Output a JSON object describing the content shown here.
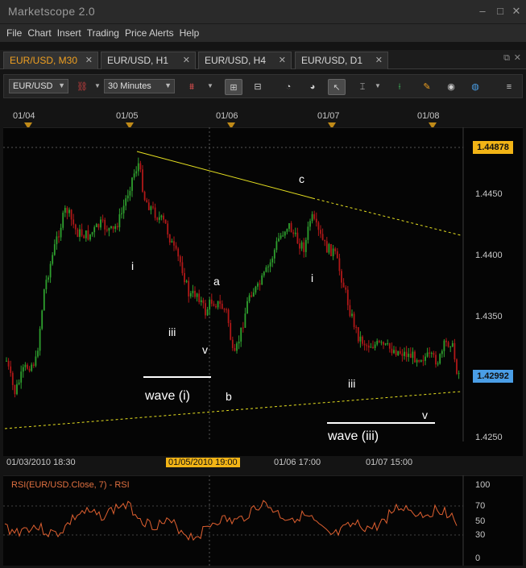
{
  "app": {
    "title": "Marketscope 2.0",
    "minimize": "–",
    "restore": "□",
    "close": "✕"
  },
  "menu": [
    "File",
    "Chart",
    "Insert",
    "Trading",
    "Price Alerts",
    "Help"
  ],
  "tabs": [
    {
      "label": "EUR/USD, M30",
      "active": true
    },
    {
      "label": "EUR/USD, H1",
      "active": false
    },
    {
      "label": "EUR/USD, H4",
      "active": false
    },
    {
      "label": "EUR/USD, D1",
      "active": false
    }
  ],
  "toolbar": {
    "instrument": "EUR/USD",
    "timeframe": "30 Minutes",
    "icons": [
      "link-icon",
      "candles-icon",
      "bar-mode-icon",
      "line-mode-icon",
      "zoom-in-icon",
      "zoom-out-icon",
      "cursor-icon",
      "crosshair-icon",
      "draw-line-icon",
      "note-icon",
      "eye-icon",
      "globe-icon",
      "scroll-icon"
    ]
  },
  "top_dates": [
    "01/04",
    "01/05",
    "01/06",
    "01/07",
    "01/08"
  ],
  "price_axis": {
    "ticks": [
      "1.4450",
      "1.4400",
      "1.4350",
      "1.4250"
    ],
    "high_box": "1.44878",
    "current_box": "1.42992",
    "high_color": "#f2b416",
    "current_color": "#4a9ee6"
  },
  "bottom_dates": {
    "d1": "01/03/2010 18:30",
    "d2": "01/05/2010 19:00",
    "d3": "01/06 17:00",
    "d4": "01/07 15:00"
  },
  "wave_labels": {
    "i1": "i",
    "iii1": "iii",
    "v1": "v",
    "a": "a",
    "b": "b",
    "c": "c",
    "i2": "i",
    "iii2": "iii",
    "v2": "v",
    "wave_i": "wave (i)",
    "wave_iii": "wave (iii)"
  },
  "rsi": {
    "title": "RSI(EUR/USD.Close, 7) - RSI",
    "ticks": [
      "100",
      "70",
      "50",
      "30",
      "0"
    ],
    "line_color": "#e06030"
  },
  "colors": {
    "up_candle": "#2ea02e",
    "down_candle": "#b01818",
    "trendline": "#e6e020"
  }
}
